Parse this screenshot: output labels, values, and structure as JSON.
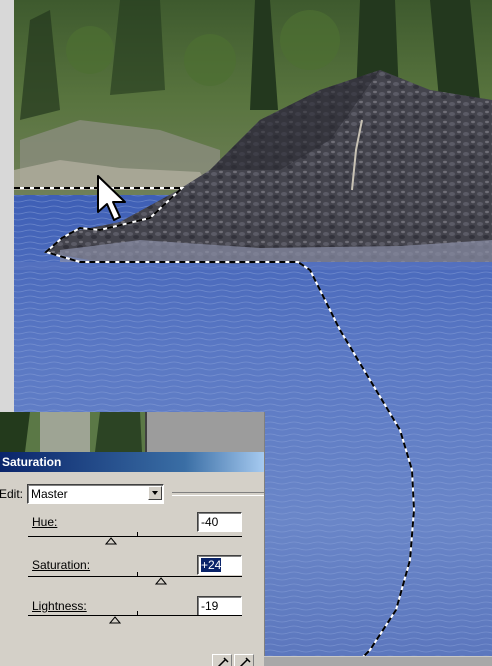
{
  "dialog": {
    "title": "Saturation",
    "edit_label": "Edit:",
    "edit_value": "Master",
    "hue": {
      "label": "Hue:",
      "value": "-40",
      "slider_fraction": 0.389
    },
    "saturation": {
      "label": "Saturation:",
      "value": "+24",
      "slider_fraction": 0.62
    },
    "lightness": {
      "label": "Lightness:",
      "value": "-19",
      "slider_fraction": 0.405
    }
  },
  "colors": {
    "titlebar": "#0a246a",
    "dialog_bg": "#d4d0c8",
    "selection_marquee": "#000000",
    "water": "#4a68b8"
  },
  "icons": {
    "cursor": "arrow-cursor-icon",
    "dropdown": "chevron-down-icon",
    "eyedropper": "eyedropper-icon",
    "eyedropper_plus": "eyedropper-plus-icon"
  }
}
